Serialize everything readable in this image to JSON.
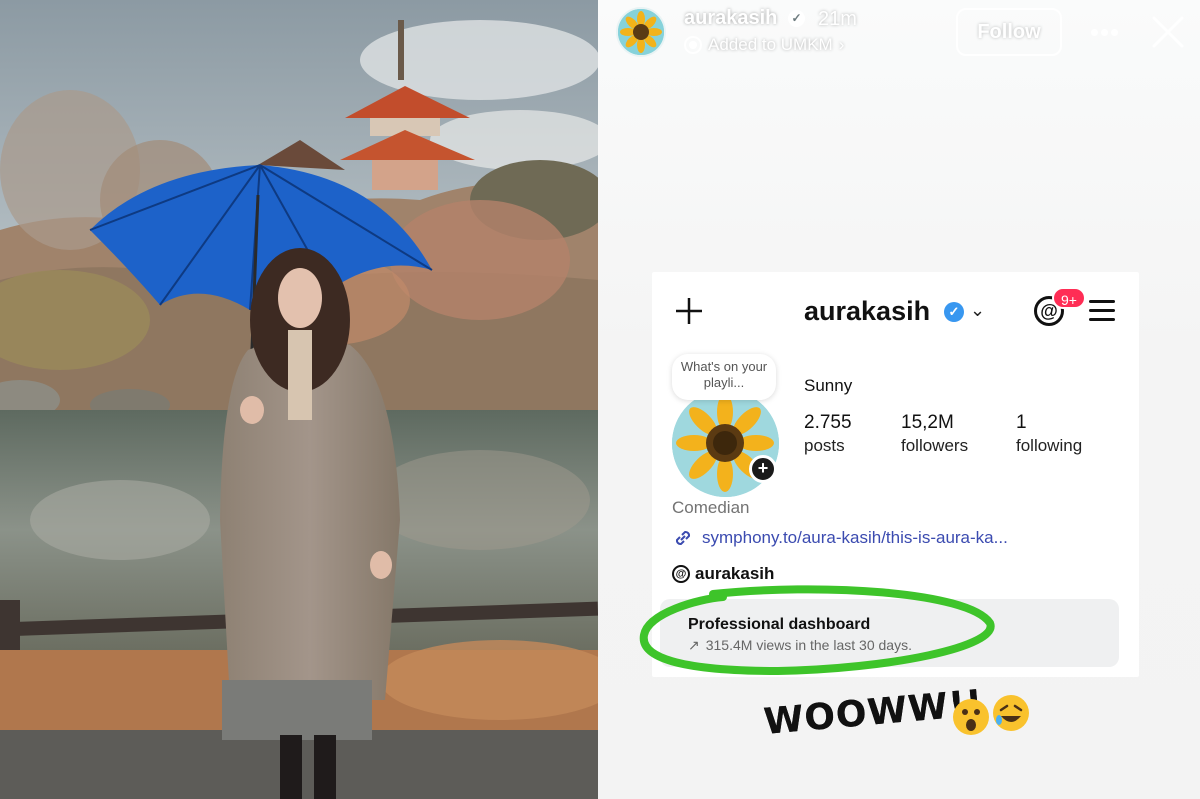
{
  "story": {
    "username": "aurakasih",
    "time": "21m",
    "added_to": "Added to UMKM",
    "follow_label": "Follow",
    "more_label": "•••"
  },
  "profile": {
    "username": "aurakasih",
    "badge_count": "9+",
    "note": "What's on your playli...",
    "display_name": "Sunny",
    "stats": [
      {
        "value": "2.755",
        "label": "posts"
      },
      {
        "value": "15,2M",
        "label": "followers"
      },
      {
        "value": "1",
        "label": "following"
      }
    ],
    "category": "Comedian",
    "link": "symphony.to/aura-kasih/this-is-aura-ka...",
    "threads_handle": "aurakasih",
    "dashboard_title": "Professional dashboard",
    "dashboard_arrow": "↗",
    "dashboard_sub": "315.4M views in the last 30 days."
  },
  "caption": {
    "text": "WOOWW!!"
  },
  "colors": {
    "highlight": "#3ec42a",
    "badge": "#ff2d55",
    "verified": "#3897f0",
    "umbrella": "#1d62c9"
  },
  "icons": [
    "verified-icon",
    "music-icon",
    "close-icon",
    "plus-icon",
    "chevron-down-icon",
    "threads-icon",
    "menu-icon",
    "link-icon",
    "trend-arrow-icon",
    "surprised-emoji-icon",
    "laughing-emoji-icon"
  ]
}
